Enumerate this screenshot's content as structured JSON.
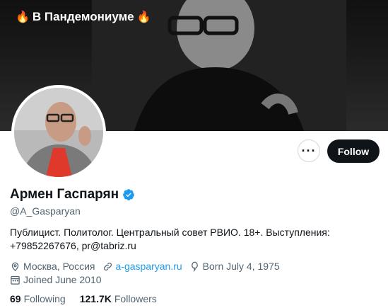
{
  "banner": {
    "title": "В Пандемониуме",
    "flame_left": "🔥",
    "flame_right": "🔥"
  },
  "actions": {
    "more_label": "···",
    "follow_label": "Follow"
  },
  "profile": {
    "name": "Армен Гаспарян",
    "handle": "@A_Gasparyan",
    "bio_line1": "Публицист. Политолог. Центральный совет РВИО. 18+. Выступления:",
    "bio_line2": "+79852267676, pr@tabriz.ru",
    "location": "Москва, Россия",
    "website": "a-gasparyan.ru",
    "birthday": "Born July 4, 1975",
    "joined": "Joined June 2010"
  },
  "stats": {
    "following_count": "69",
    "following_label": "Following",
    "followers_count": "121.7K",
    "followers_label": "Followers"
  },
  "colors": {
    "accent": "#1d9bf0",
    "primary_text": "#0f1419",
    "secondary_text": "#536471",
    "follow_bg": "#0f1419"
  }
}
